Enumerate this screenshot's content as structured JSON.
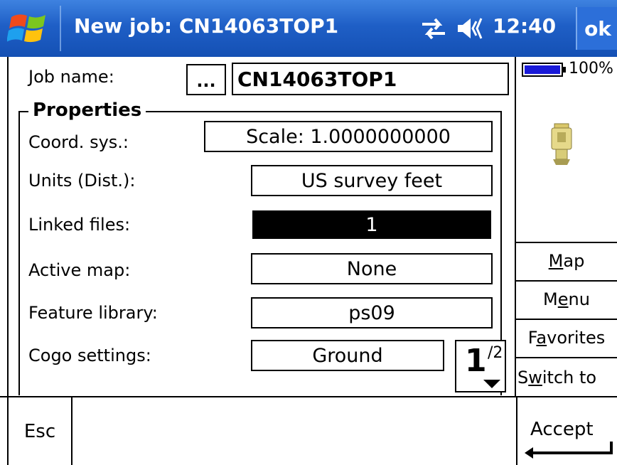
{
  "titlebar": {
    "title": "New job: CN14063TOP1",
    "time": "12:40",
    "ok_label": "ok",
    "start_icon": "windows-start-icon",
    "connectivity_icon": "sync-arrows-icon",
    "volume_icon": "speaker-icon",
    "bg_color": "#1f5fc6"
  },
  "job": {
    "name_label": "Job name:",
    "browse_label": "...",
    "name_value": "CN14063TOP1"
  },
  "properties": {
    "group_title": "Properties",
    "rows": [
      {
        "label": "Coord. sys.:",
        "value": "Scale:  1.0000000000"
      },
      {
        "label": "Units (Dist.):",
        "value": "US survey feet"
      },
      {
        "label": "Linked files:",
        "value": "1"
      },
      {
        "label": "Active map:",
        "value": "None"
      },
      {
        "label": "Feature library:",
        "value": "ps09"
      },
      {
        "label": "Cogo settings:",
        "value": "Ground"
      }
    ],
    "page_current": "1",
    "page_total": "/2"
  },
  "status": {
    "battery": "100%",
    "battery_color": "#1a1ad8",
    "instrument_icon": "total-station-icon"
  },
  "side_menu": {
    "map": {
      "pre": "",
      "accel": "M",
      "post": "ap"
    },
    "menu": {
      "pre": "M",
      "accel": "e",
      "post": "nu"
    },
    "favorites": {
      "pre": "F",
      "accel": "a",
      "post": "vorites"
    },
    "switch_to": {
      "pre": "S",
      "accel": "w",
      "post": "itch to"
    }
  },
  "footer": {
    "esc_label": "Esc",
    "accept_label": "Accept"
  }
}
